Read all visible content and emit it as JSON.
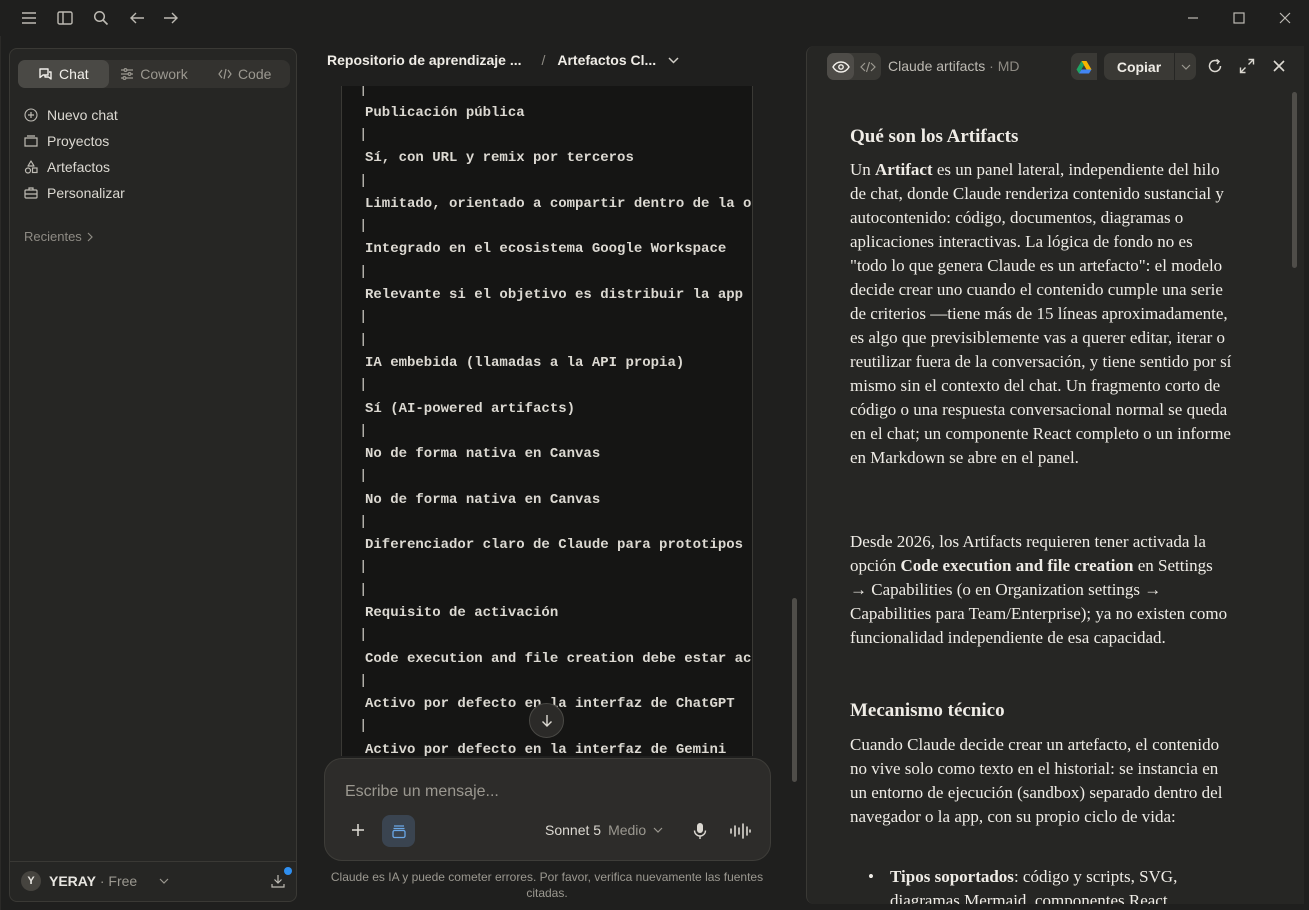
{
  "sidebar": {
    "modes": [
      {
        "label": "Chat",
        "icon": "chat-bubbles-icon",
        "active": true
      },
      {
        "label": "Cowork",
        "icon": "sliders-icon",
        "active": false
      },
      {
        "label": "Code",
        "icon": "code-brackets-icon",
        "active": false
      }
    ],
    "nav": [
      {
        "label": "Nuevo chat",
        "icon": "plus-circle-icon"
      },
      {
        "label": "Proyectos",
        "icon": "folder-icon"
      },
      {
        "label": "Artefactos",
        "icon": "shapes-icon"
      },
      {
        "label": "Personalizar",
        "icon": "briefcase-icon"
      }
    ],
    "recents_label": "Recientes",
    "user": {
      "initial": "Y",
      "name": "YERAY",
      "plan_separator": " · ",
      "plan": "Free"
    }
  },
  "breadcrumb": {
    "project": "Repositorio de aprendizaje ...",
    "separator": "/",
    "chat": "Artefactos Cl..."
  },
  "code_lines": [
    "Publicación pública",
    "Sí, con URL y remix por terceros",
    "Limitado, orientado a compartir dentro de la organización",
    "Integrado en el ecosistema Google Workspace",
    "Relevante si el objetivo es distribuir la app fuera",
    "IA embebida (llamadas a la API propia)",
    "Sí (AI-powered artifacts)",
    "No de forma nativa en Canvas",
    "No de forma nativa en Canvas",
    "Diferenciador claro de Claude para prototipos",
    "Requisito de activación",
    "Code execution and file creation debe estar activo",
    "Activo por defecto en la interfaz de ChatGPT",
    "Activo por defecto en la interfaz de Gemini"
  ],
  "pipe_char": "|",
  "composer": {
    "placeholder": "Escribe un mensaje...",
    "model": "Sonnet 5",
    "effort": "Medio"
  },
  "disclaimer": "Claude es IA y puede cometer errores. Por favor, verifica nuevamente las fuentes citadas.",
  "artifact": {
    "title": "Claude artifacts",
    "title_sep": " · ",
    "ext": "MD",
    "copy_label": "Copiar",
    "h1": "Qué son los Artifacts",
    "p1_a": "Un ",
    "p1_b": "Artifact",
    "p1_c": " es un panel lateral, independiente del hilo de chat, donde Claude renderiza contenido sustancial y autocontenido: código, documentos, diagramas o aplicaciones interactivas. La lógica de fondo no es \"todo lo que genera Claude es un artefacto\": el modelo decide crear uno cuando el contenido cumple una serie de criterios —tiene más de 15 líneas aproximadamente, es algo que previsiblemente vas a querer editar, iterar o reutilizar fuera de la conversación, y tiene sentido por sí mismo sin el contexto del chat. Un fragmento corto de código o una respuesta conversacional normal se queda en el chat; un componente React completo o un informe en Markdown se abre en el panel.",
    "p2_a": "Desde 2026, los Artifacts requieren tener activada la opción ",
    "p2_b": "Code execution and file creation",
    "p2_c": " en Settings → Capabilities (o en Organization settings → Capabilities para Team/Enterprise); ya no existen como funcionalidad independiente de esa capacidad.",
    "h2": "Mecanismo técnico",
    "p3": "Cuando Claude decide crear un artefacto, el contenido no vive solo como texto en el historial: se instancia en un entorno de ejecución (sandbox) separado dentro del navegador o la app, con su propio ciclo de vida:",
    "li1_b": "Tipos soportados",
    "li1_c": ": código y scripts, SVG, diagramas Mermaid, componentes React"
  },
  "colors": {
    "background": "#1f1f1e",
    "panel": "#262624",
    "accent": "#2f8ff0"
  }
}
